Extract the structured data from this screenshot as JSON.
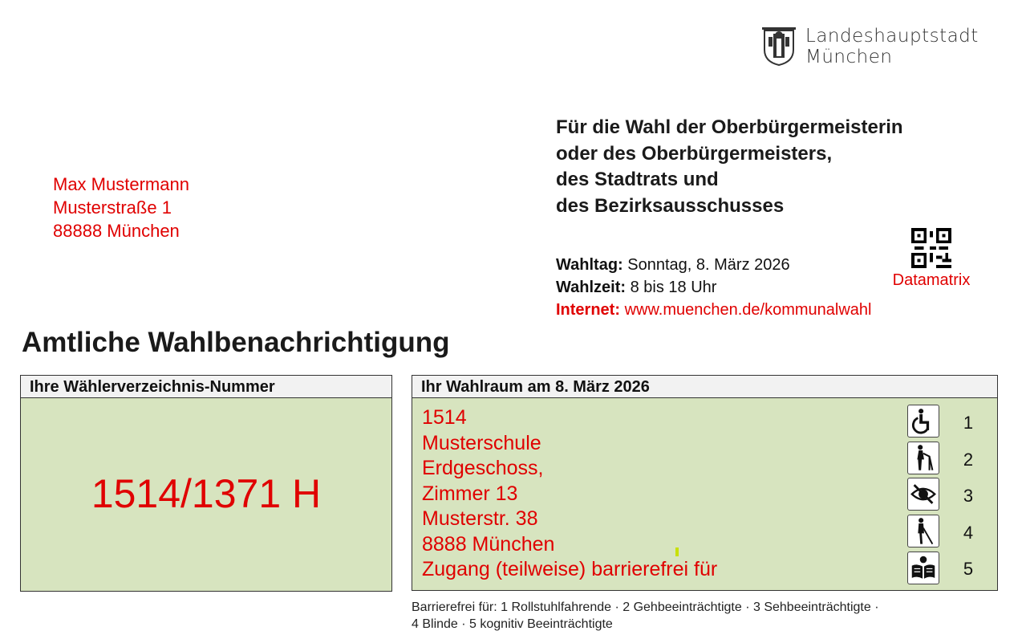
{
  "logo": {
    "line1": "Landeshauptstadt",
    "line2": "München"
  },
  "recipient": {
    "name": "Max Mustermann",
    "street": "Musterstraße 1",
    "city": "88888 München"
  },
  "election": {
    "title_lines": [
      "Für die Wahl der Oberbürgermeisterin",
      "oder des Oberbürgermeisters,",
      "des Stadtrats und",
      "des Bezirksausschusses"
    ]
  },
  "info": {
    "date_label": "Wahltag:",
    "date_value": "Sonntag, 8. März 2026",
    "time_label": "Wahlzeit:",
    "time_value": "8 bis 18 Uhr",
    "internet_label": "Internet:",
    "internet_value": "www.muenchen.de/kommunalwahl"
  },
  "datamatrix_label": "Datamatrix",
  "heading": "Amtliche Wahlbenachrichtigung",
  "voter_box": {
    "header": "Ihre Wählerverzeichnis-Nummer",
    "number": "1514/1371 H"
  },
  "room_box": {
    "header": "Ihr Wahlraum am 8. März 2026",
    "lines": [
      "1514",
      "Musterschule",
      "Erdgeschoss,",
      "Zimmer 13",
      "Musterstr. 38",
      "8888 München",
      "Zugang (teilweise) barrierefrei für"
    ],
    "accessibility": [
      {
        "num": "1",
        "icon": "wheelchair-icon"
      },
      {
        "num": "2",
        "icon": "walker-icon"
      },
      {
        "num": "3",
        "icon": "visually-impaired-icon"
      },
      {
        "num": "4",
        "icon": "blind-person-icon"
      },
      {
        "num": "5",
        "icon": "easy-reading-icon"
      }
    ]
  },
  "legend": {
    "line1": "Barrierefrei für: 1 Rollstuhlfahrende · 2 Gehbeeinträchtigte · 3 Sehbeeinträchtigte ·",
    "line2": "4 Blinde · 5 kognitiv Beeinträchtigte"
  },
  "colors": {
    "accent_red": "#e00000",
    "box_green": "#d7e4bf",
    "header_gray": "#f2f2f2"
  }
}
